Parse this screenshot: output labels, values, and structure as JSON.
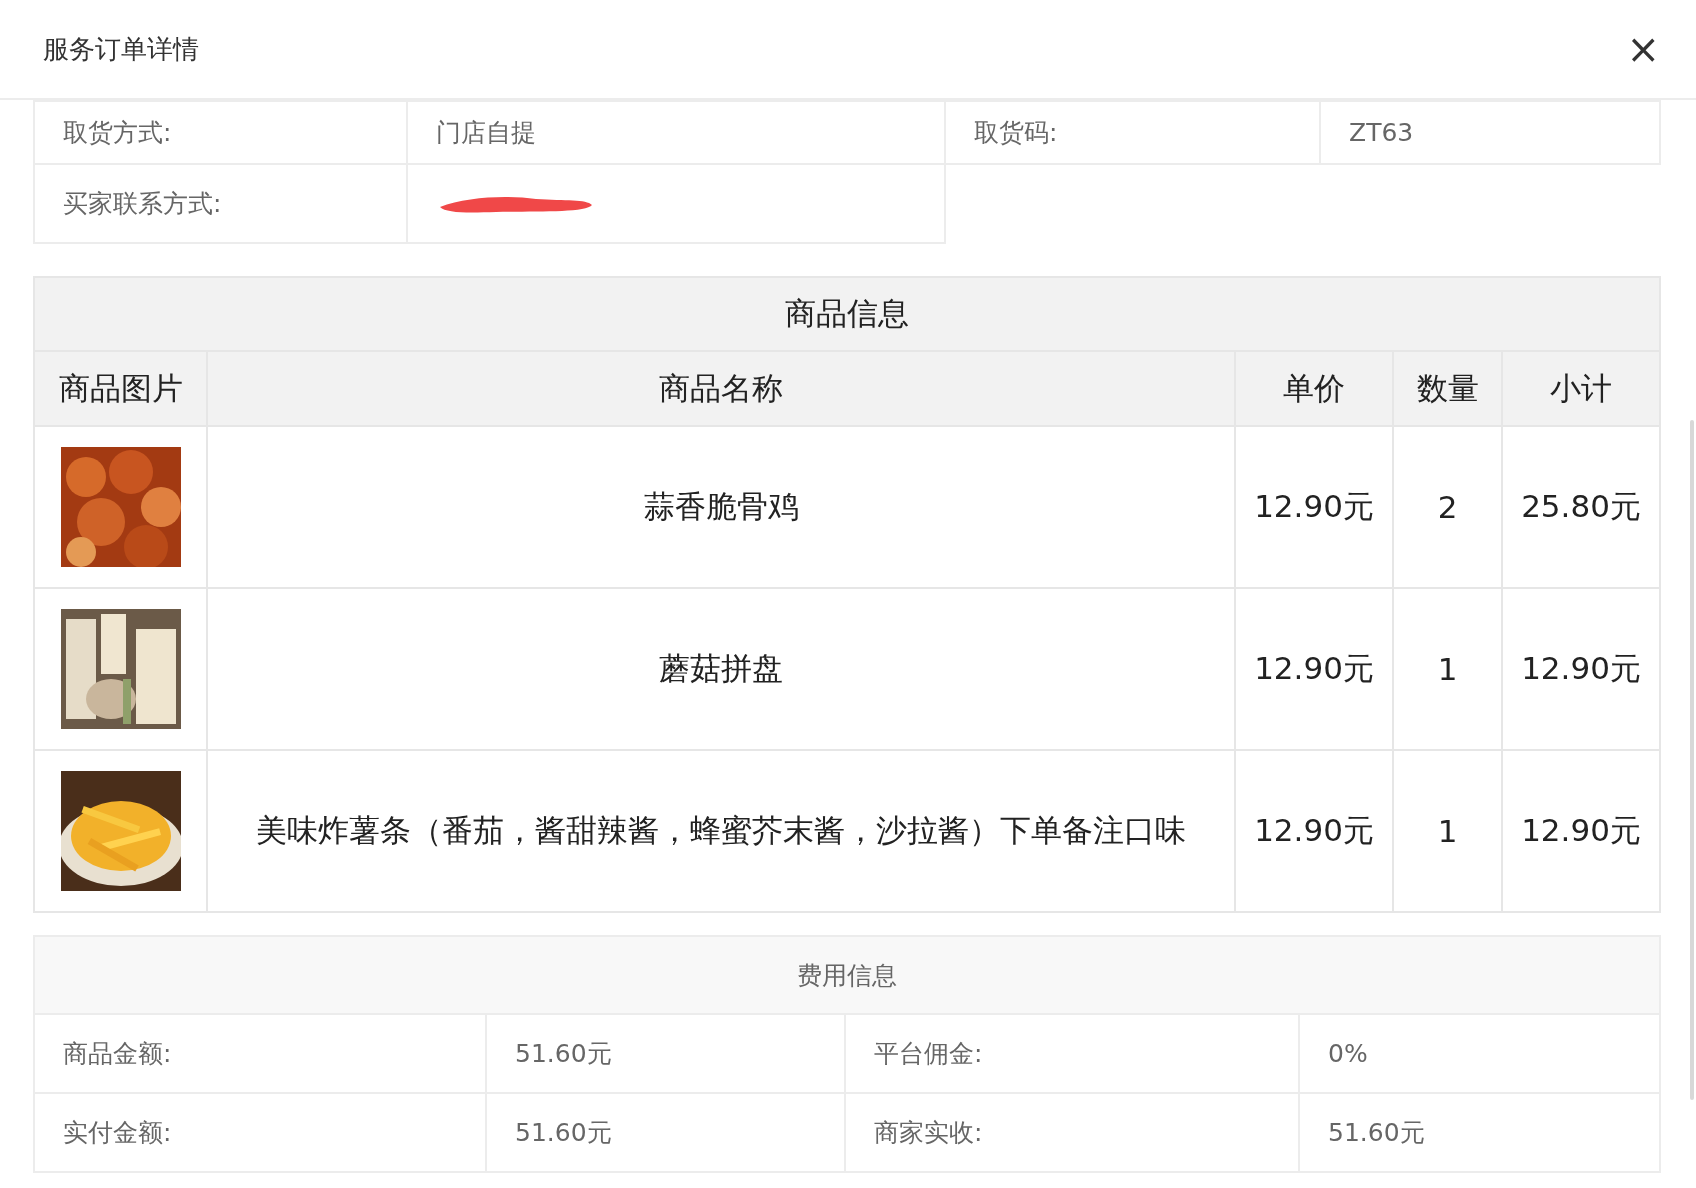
{
  "dialog": {
    "title": "服务订单详情",
    "close": "×"
  },
  "order_info": [
    {
      "label": "取货方式:",
      "value": "门店自提",
      "label_2": "取货码:",
      "value_2": "ZT63"
    },
    {
      "label": "买家联系方式:"
    }
  ],
  "goods": {
    "title": "商品信息",
    "columns": [
      "商品图片",
      "商品名称",
      "单价",
      "数量",
      "小计"
    ],
    "rows": [
      {
        "name": "蒜香脆骨鸡",
        "price": "12.90元",
        "qty": "2",
        "subtotal": "25.80元"
      },
      {
        "name": "蘑菇拼盘",
        "price": "12.90元",
        "qty": "1",
        "subtotal": "12.90元"
      },
      {
        "name": "美味炸薯条（番茄，酱甜辣酱，蜂蜜芥末酱，沙拉酱）下单备注口味",
        "price": "12.90元",
        "qty": "1",
        "subtotal": "12.90元"
      }
    ]
  },
  "fees": {
    "title": "费用信息",
    "rows": [
      {
        "label": "商品金额:",
        "value": "51.60元",
        "label_2": "平台佣金:",
        "value_2": "0%"
      },
      {
        "label": "实付金额:",
        "value": "51.60元",
        "label_2": "商家实收:",
        "value_2": "51.60元"
      }
    ]
  }
}
